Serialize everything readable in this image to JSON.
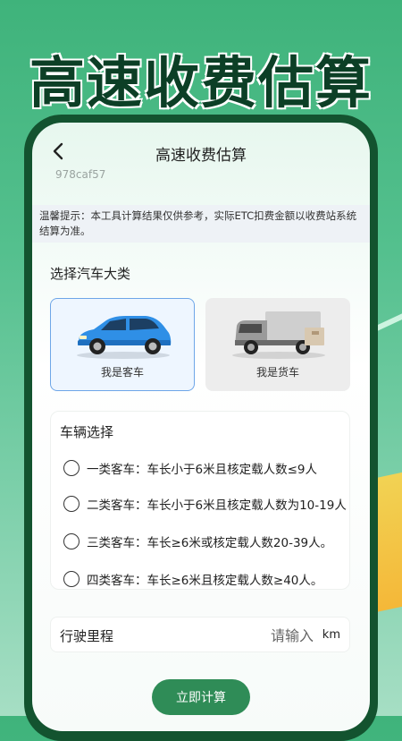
{
  "banner": {
    "headline": "高速收费估算"
  },
  "nav": {
    "title": "高速收费估算",
    "build_id": "978caf57"
  },
  "notice": {
    "text": "温馨提示：本工具计算结果仅供参考，实际ETC扣费金额以收费站系统结算为准。"
  },
  "vehicle_class": {
    "label": "选择汽车大类",
    "options": [
      {
        "label": "我是客车",
        "icon": "passenger-car-icon",
        "selected": true
      },
      {
        "label": "我是货车",
        "icon": "truck-icon",
        "selected": false
      }
    ]
  },
  "vehicle_select": {
    "title": "车辆选择",
    "options": [
      {
        "label": "一类客车：车长小于6米且核定载人数≤9人"
      },
      {
        "label": "二类客车：车长小于6米且核定载人数为10-19人"
      },
      {
        "label": "三类客车：车长≥6米或核定载人数20-39人。"
      },
      {
        "label": "四类客车：车长≥6米且核定载人数≥40人。"
      }
    ]
  },
  "mileage": {
    "label": "行驶里程",
    "placeholder": "请输入",
    "value": "",
    "unit": "km"
  },
  "action": {
    "calculate_label": "立即计算"
  },
  "colors": {
    "accent": "#2f8c57",
    "headline": "#0c3f26",
    "selected_border": "#6ea6e8"
  }
}
